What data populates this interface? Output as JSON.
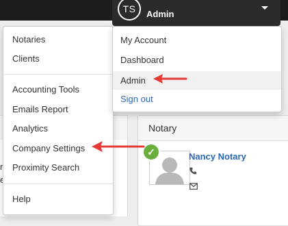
{
  "header": {
    "user_initials": "TS",
    "user_role": "Admin"
  },
  "main_menu": {
    "items": [
      "Notaries",
      "Clients",
      "Accounting Tools",
      "Emails Report",
      "Analytics",
      "Company Settings",
      "Proximity Search",
      "Help"
    ],
    "highlighted_item": "Company Settings"
  },
  "account_menu": {
    "items": [
      "My Account",
      "Dashboard",
      "Admin",
      "Sign out"
    ],
    "active_item": "Admin"
  },
  "notary_panel": {
    "title": "Notary",
    "name": "Nancy Notary",
    "verified_icon": "check-circle-icon",
    "phone_icon": "phone-icon",
    "email_icon": "envelope-icon"
  },
  "background_fragment": {
    "line1": "r",
    "line2": "e"
  },
  "colors": {
    "annotation_arrow": "#e53935",
    "link_blue": "#2a66b8",
    "topbar": "#1c1c1c",
    "verified_green": "#6aaf3d"
  }
}
